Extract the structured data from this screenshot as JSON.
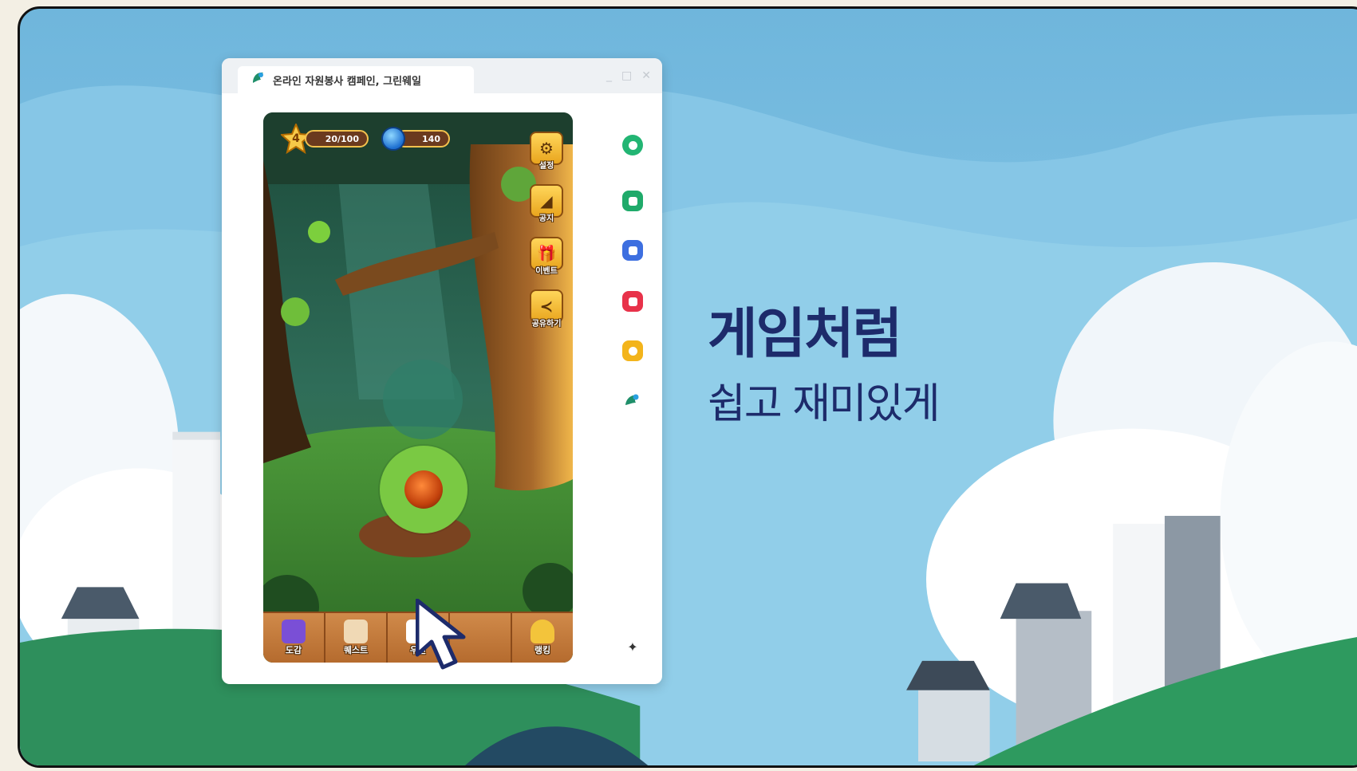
{
  "window": {
    "tab_title": "온라인 자원봉사 캠페인, 그린웨일",
    "controls": [
      "_",
      "□",
      "✕"
    ]
  },
  "game": {
    "level": "4",
    "xp": "20/100",
    "gems": "140",
    "side_buttons": [
      {
        "icon": "gear-icon",
        "label": "설정"
      },
      {
        "icon": "megaphone-icon",
        "label": "공지"
      },
      {
        "icon": "gift-icon",
        "label": "이벤트"
      },
      {
        "icon": "share-icon",
        "label": "공유하기"
      }
    ],
    "bottom_menu": [
      {
        "icon": "book-icon",
        "label": "도감"
      },
      {
        "icon": "scroll-icon",
        "label": "퀘스트"
      },
      {
        "icon": "mail-icon",
        "label": "우편"
      },
      {
        "icon": "cursor-hidden-icon",
        "label": ""
      },
      {
        "icon": "trophy-icon",
        "label": "랭킹"
      }
    ]
  },
  "side_icons": [
    {
      "name": "green-circle-icon",
      "color": "#22b573"
    },
    {
      "name": "green-square-icon",
      "color": "#1faa6a"
    },
    {
      "name": "blue-chat-icon",
      "color": "#3d6fe0"
    },
    {
      "name": "red-heart-icon",
      "color": "#e8324a"
    },
    {
      "name": "yellow-star-icon",
      "color": "#f3b41b"
    },
    {
      "name": "whale-logo-icon",
      "color": "#1f8f6a"
    }
  ],
  "headline": {
    "line1": "게임처럼",
    "line2": "쉽고 재미있게"
  },
  "colors": {
    "headline": "#1d2b6b",
    "sky": "#7fc1e3"
  }
}
